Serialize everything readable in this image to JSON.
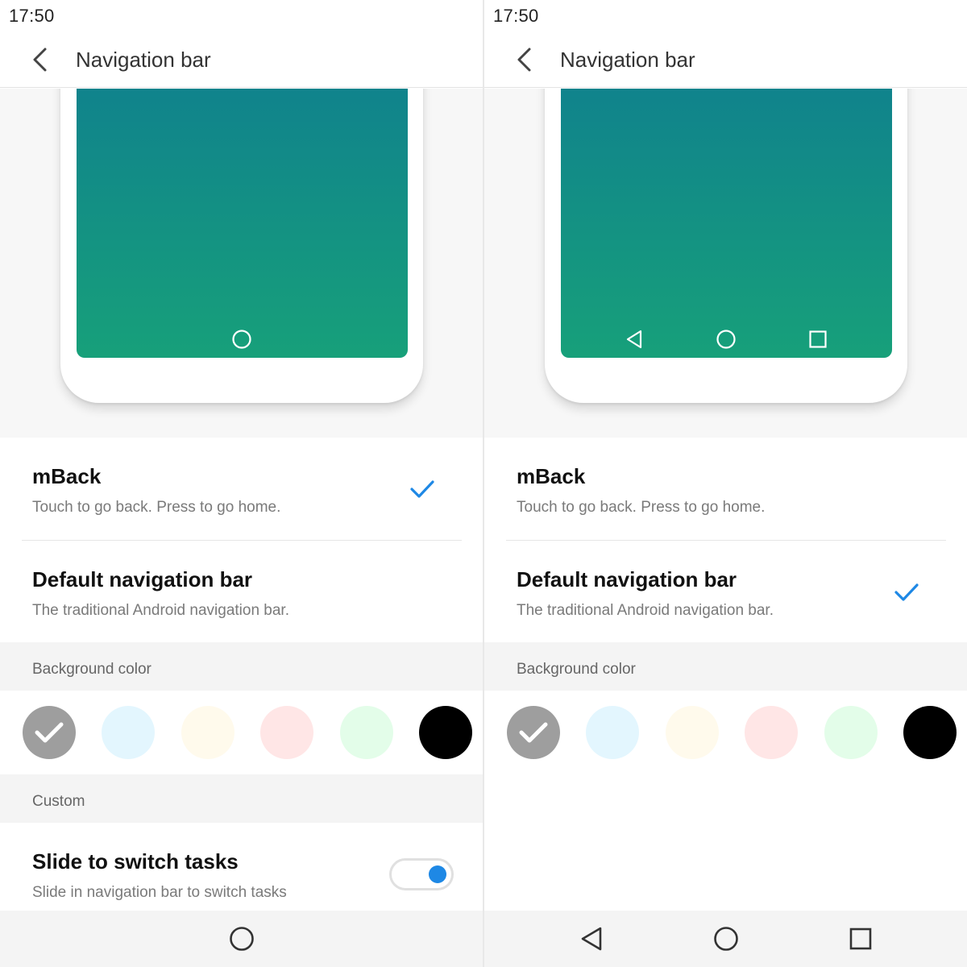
{
  "colors": {
    "accent": "#1e88e5",
    "swatch_gray": "#9e9e9e",
    "swatch_blue": "#e3f6fe",
    "swatch_cream": "#fffaec",
    "swatch_pink": "#ffe6e6",
    "swatch_green": "#e3fde9",
    "swatch_black": "#000000",
    "icon_dark": "#333333"
  },
  "left": {
    "status_time": "17:50",
    "app_title": "Navigation bar",
    "options": [
      {
        "title": "mBack",
        "subtitle": "Touch to go back. Press to go home.",
        "selected": true
      },
      {
        "title": "Default navigation bar",
        "subtitle": "The traditional Android navigation bar.",
        "selected": false
      }
    ],
    "bg_color_header": "Background color",
    "custom_header": "Custom",
    "toggle": {
      "title": "Slide to switch tasks",
      "subtitle": "Slide in navigation bar to switch tasks",
      "on": true
    },
    "selected_swatch": "gray"
  },
  "right": {
    "status_time": "17:50",
    "app_title": "Navigation bar",
    "options": [
      {
        "title": "mBack",
        "subtitle": "Touch to go back. Press to go home.",
        "selected": false
      },
      {
        "title": "Default navigation bar",
        "subtitle": "The traditional Android navigation bar.",
        "selected": true
      }
    ],
    "bg_color_header": "Background color",
    "selected_swatch": "gray"
  },
  "icons": {
    "back": "chevron-left-icon",
    "check": "checkmark-icon",
    "home": "circle-home-icon",
    "nav_back": "triangle-back-icon",
    "recents": "square-recents-icon"
  }
}
